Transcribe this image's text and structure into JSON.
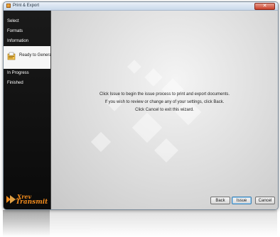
{
  "window": {
    "title": "Print & Export",
    "close_glyph": "✕"
  },
  "sidebar": {
    "items": [
      {
        "label": "Select"
      },
      {
        "label": "Formats"
      },
      {
        "label": "Information"
      },
      {
        "label": "Ready to Generate",
        "active": true
      },
      {
        "label": "In Progress"
      },
      {
        "label": "Finished"
      }
    ],
    "active_icon": "document-generate-icon",
    "logo": {
      "line1": "Xrev",
      "line2": "Transmit"
    }
  },
  "main": {
    "lines": [
      "Click Issue to begin the issue process to print and export documents.",
      "If you wish to review or change any of your settings, click Back.",
      "Click Cancel to exit this wizard."
    ]
  },
  "buttons": {
    "back": "Back",
    "issue": "Issue",
    "cancel": "Cancel"
  }
}
